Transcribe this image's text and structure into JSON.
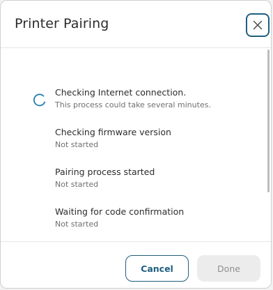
{
  "dialog": {
    "title": "Printer Pairing",
    "close_icon": "close-icon"
  },
  "steps": [
    {
      "title": "Checking Internet connection.",
      "status": "This process could take several minutes.",
      "state": "in-progress"
    },
    {
      "title": "Checking firmware version",
      "status": "Not started",
      "state": "pending"
    },
    {
      "title": "Pairing process started",
      "status": "Not started",
      "state": "pending"
    },
    {
      "title": "Waiting for code confirmation",
      "status": "Not started",
      "state": "pending"
    }
  ],
  "footer": {
    "cancel_label": "Cancel",
    "done_label": "Done"
  },
  "colors": {
    "accent": "#1f5e80",
    "spinner": "#2a7fb0",
    "disabled_bg": "#ececec",
    "disabled_text": "#8f8f8f"
  }
}
